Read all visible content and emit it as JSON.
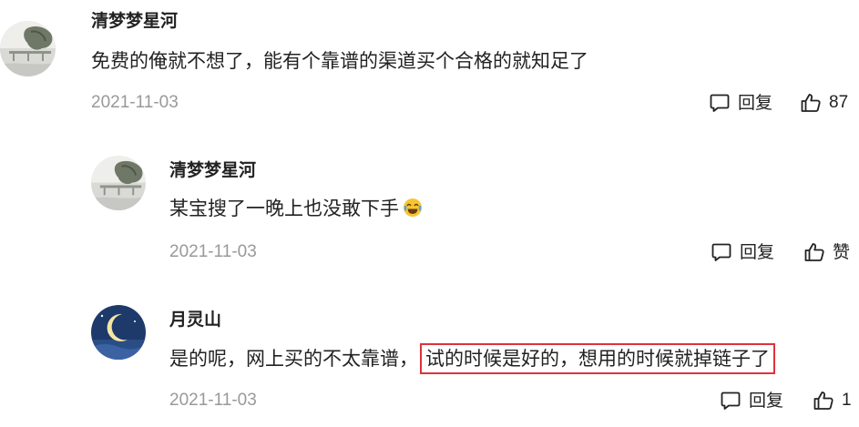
{
  "comments": [
    {
      "author": "清梦梦星河",
      "text": "免费的俺就不想了，能有个靠谱的渠道买个合格的就知足了",
      "date": "2021-11-03",
      "reply_label": "回复",
      "like_label": "87",
      "avatar": "landscape-avatar"
    },
    {
      "author": "清梦梦星河",
      "text": "某宝搜了一晚上也没敢下手",
      "emoji": "crying-laughing-emoji",
      "date": "2021-11-03",
      "reply_label": "回复",
      "like_label": "赞",
      "avatar": "landscape-avatar"
    },
    {
      "author": "月灵山",
      "text_plain": "是的呢，网上买的不太靠谱，",
      "text_highlight": "试的时候是好的，想用的时候就掉链子了",
      "highlight_color": "#e0313b",
      "date": "2021-11-03",
      "reply_label": "回复",
      "like_label": "1",
      "avatar": "moon-night-avatar"
    }
  ],
  "colors": {
    "text": "#222222",
    "meta": "#999999",
    "highlight_border": "#e0313b",
    "moon_bg": "#1e3a6b",
    "moon": "#f4e7a1"
  },
  "icons": {
    "reply": "comment-bubble-icon",
    "like": "thumbs-up-icon"
  }
}
